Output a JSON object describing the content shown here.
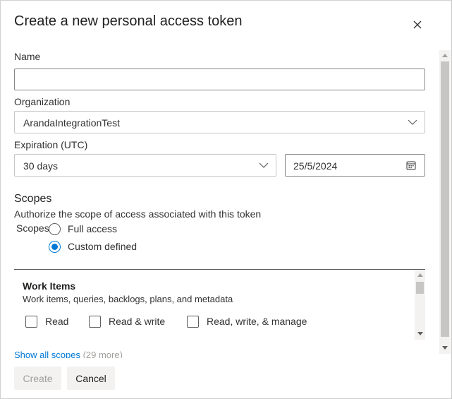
{
  "dialog": {
    "title": "Create a new personal access token"
  },
  "form": {
    "name_label": "Name",
    "name_value": "",
    "organization_label": "Organization",
    "organization_value": "ArandaIntegrationTest",
    "expiration_label": "Expiration (UTC)",
    "expiration_value": "30 days",
    "expiration_date": "25/5/2024"
  },
  "scopes": {
    "title": "Scopes",
    "description": "Authorize the scope of access associated with this token",
    "radio_group_label": "Scopes",
    "options": [
      {
        "label": "Full access",
        "selected": false
      },
      {
        "label": "Custom defined",
        "selected": true
      }
    ]
  },
  "work_items": {
    "title": "Work Items",
    "description": "Work items, queries, backlogs, plans, and metadata",
    "permissions": [
      "Read",
      "Read & write",
      "Read, write, & manage"
    ]
  },
  "show_all": {
    "link_text": "Show all scopes",
    "count_text": "(29 more)"
  },
  "buttons": {
    "create": "Create",
    "cancel": "Cancel"
  },
  "colors": {
    "accent": "#0078d4",
    "disabled_text": "#a19f9d"
  }
}
